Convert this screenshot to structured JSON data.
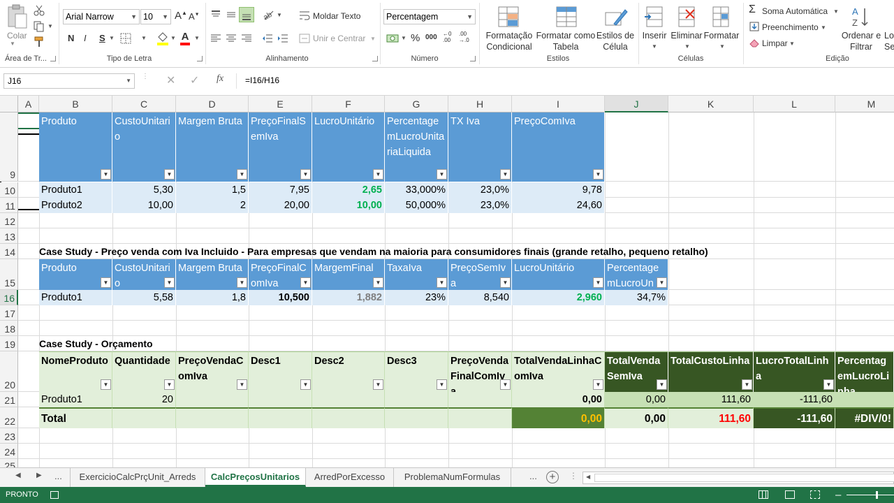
{
  "ribbon": {
    "clipboard": {
      "paste": "Colar",
      "label": "Área de Tr..."
    },
    "font": {
      "name": "Arial Narrow",
      "size": "10",
      "label": "Tipo de Letra",
      "bold": "N",
      "italic": "I",
      "underline": "S"
    },
    "alignment": {
      "wrap": "Moldar Texto",
      "merge": "Unir e Centrar",
      "label": "Alinhamento"
    },
    "number": {
      "format": "Percentagem",
      "label": "Número",
      "percent": "%",
      "thousands": "000"
    },
    "styles": {
      "conditional": "Formatação\nCondicional",
      "table": "Formatar como\nTabela",
      "cell": "Estilos de\nCélula",
      "label": "Estilos"
    },
    "cells": {
      "insert": "Inserir",
      "delete": "Eliminar",
      "format": "Formatar",
      "label": "Células"
    },
    "editing": {
      "autosum": "Soma Automática",
      "fill": "Preenchimento",
      "clear": "Limpar",
      "sort": "Ordenar e\nFiltrar",
      "select": "Lo\nSel",
      "label": "Edição"
    }
  },
  "formula_bar": {
    "name_box": "J16",
    "fx": "fx",
    "formula": "=I16/H16"
  },
  "columns": [
    "A",
    "B",
    "C",
    "D",
    "E",
    "F",
    "G",
    "H",
    "I",
    "J",
    "K",
    "L",
    "M"
  ],
  "rows": [
    "9",
    "10",
    "11",
    "12",
    "13",
    "14",
    "15",
    "16",
    "17",
    "18",
    "19",
    "20",
    "21",
    "22",
    "23",
    "24",
    "25"
  ],
  "table1": {
    "headers": [
      "Produto",
      "CustoUnitario",
      "Margem Bruta",
      "PreçoFinalSemIva",
      "LucroUnitário",
      "PercentagemLucroUnitariaLiquida",
      "TX Iva",
      "PreçoComIva"
    ],
    "rows": [
      [
        "Produto1",
        "5,30",
        "1,5",
        "7,95",
        "2,65",
        "33,000%",
        "23,0%",
        "9,78"
      ],
      [
        "Produto2",
        "10,00",
        "2",
        "20,00",
        "10,00",
        "50,000%",
        "23,0%",
        "24,60"
      ]
    ]
  },
  "case1_title": "Case Study - Preço venda com Iva Incluido - Para empresas que vendam na maioria para consumidores finais (grande retalho, pequeno retalho)",
  "table2": {
    "headers": [
      "Produto",
      "CustoUnitario",
      "Margem Bruta",
      "PreçoFinalComIva",
      "MargemFinal",
      "TaxaIva",
      "PreçoSemIva",
      "LucroUnitário",
      "PercentagemLucroUn"
    ],
    "row": [
      "Produto1",
      "5,58",
      "1,8",
      "10,500",
      "1,882",
      "23%",
      "8,540",
      "2,960",
      "34,7%"
    ]
  },
  "case2_title": "Case Study - Orçamento",
  "table3": {
    "headers": [
      "NomeProduto",
      "Quantidade",
      "PreçoVendaComIva",
      "Desc1",
      "Desc2",
      "Desc3",
      "PreçoVendaFinalComIva",
      "TotalVendaLinhaComIva",
      "TotalVendaSemIva",
      "TotalCustoLinha",
      "LucroTotalLinha",
      "PercentagemLucroLinha"
    ],
    "row": [
      "Produto1",
      "20",
      "",
      "",
      "",
      "",
      "",
      "0,00",
      "0,00",
      "111,60",
      "-111,60",
      ""
    ],
    "total": [
      "Total",
      "",
      "",
      "",
      "",
      "",
      "",
      "0,00",
      "0,00",
      "111,60",
      "-111,60",
      "#DIV/0!"
    ]
  },
  "sheet_tabs": [
    "ExercicioCalcPrçUnit_Arreds",
    "CalcPreçosUnitarios",
    "ArredPorExcesso",
    "ProblemaNumFormulas"
  ],
  "status": {
    "mode": "PRONTO"
  },
  "colors": {
    "excel_green": "#217346",
    "header_blue": "#5b9bd5",
    "band_blue": "#ddebf7",
    "header_green": "#e2efda",
    "dark_green": "#375623",
    "gold": "#ffc000",
    "red": "#ff0000",
    "pos_green": "#00b050"
  }
}
